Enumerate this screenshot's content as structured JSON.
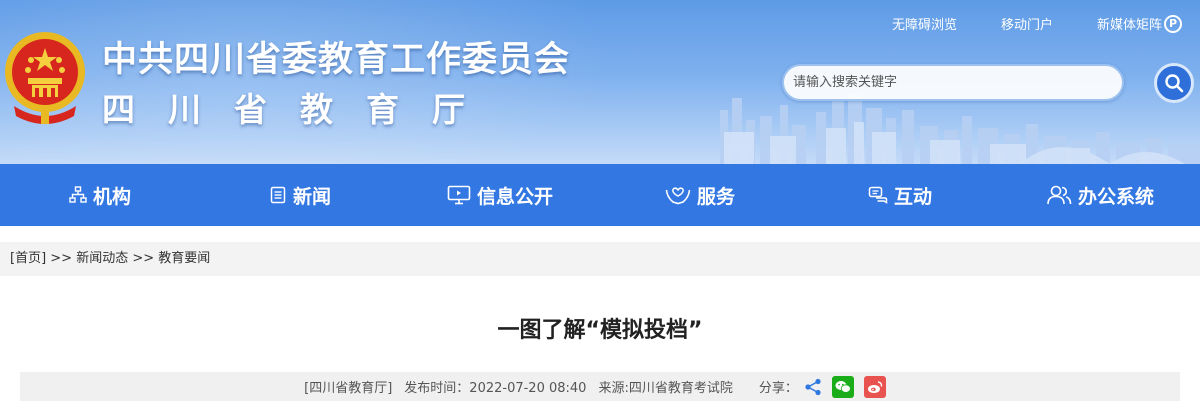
{
  "header": {
    "title_main": "中共四川省委教育工作委员会",
    "title_sub": "四川省教育厅",
    "top_links": [
      "无障碍浏览",
      "移动门户",
      "新媒体矩阵"
    ],
    "media_badge": "P",
    "search": {
      "placeholder": "请输入搜索关键字"
    }
  },
  "nav": {
    "items": [
      {
        "label": "机构",
        "icon": "org-chart-icon"
      },
      {
        "label": "新闻",
        "icon": "news-icon"
      },
      {
        "label": "信息公开",
        "icon": "monitor-icon"
      },
      {
        "label": "服务",
        "icon": "hands-heart-icon"
      },
      {
        "label": "互动",
        "icon": "chat-icon"
      },
      {
        "label": "办公系统",
        "icon": "users-icon"
      }
    ]
  },
  "breadcrumb": {
    "home": "[首页]",
    "sep1": " >> ",
    "item1": "新闻动态",
    "sep2": " >> ",
    "item2": "教育要闻"
  },
  "article": {
    "title": "一图了解“模拟投档”",
    "source_tag": "[四川省教育厅]",
    "publish_time": "发布时间：2022-07-20 08:40",
    "origin": "来源:四川省教育考试院",
    "share_label": "分享："
  },
  "colors": {
    "nav_bg": "#3377e3",
    "search_btn": "#2f6fd9",
    "wechat": "#1aad19",
    "weibo": "#e8534f"
  }
}
